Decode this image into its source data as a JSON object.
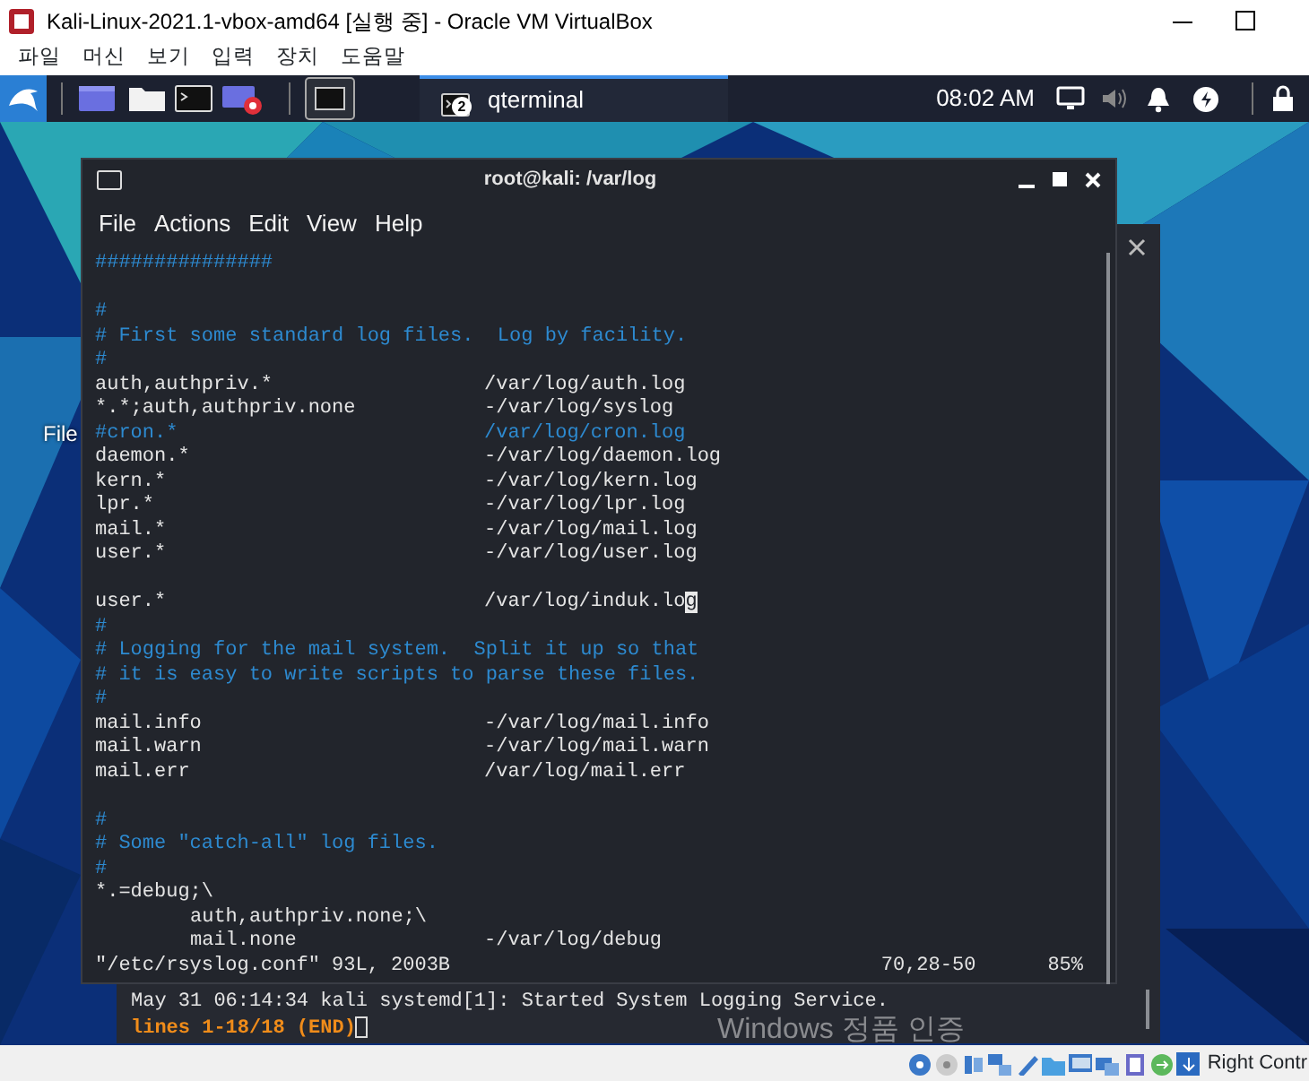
{
  "vm_window": {
    "title": "Kali-Linux-2021.1-vbox-amd64 [실행 중] - Oracle VM VirtualBox",
    "menu": [
      "파일",
      "머신",
      "보기",
      "입력",
      "장치",
      "도움말"
    ]
  },
  "panel": {
    "clock": "08:02 AM",
    "task": {
      "label": "qterminal",
      "badge": "2"
    }
  },
  "desktop": {
    "icon_label": "File"
  },
  "back_terminal": {
    "lines": [
      {
        "kind": "log",
        "text": "May 31 06:14:34 kali systemd[1]: Started System Logging Service."
      },
      {
        "kind": "pager",
        "text": "lines 1-18/18 (END)"
      }
    ]
  },
  "terminal": {
    "title": "root@kali: /var/log",
    "menu": [
      "File",
      "Actions",
      "Edit",
      "View",
      "Help"
    ],
    "lines": [
      {
        "kind": "comment",
        "text": "###############"
      },
      {
        "kind": "blank"
      },
      {
        "kind": "comment",
        "text": "#"
      },
      {
        "kind": "comment",
        "text": "# First some standard log files.  Log by facility."
      },
      {
        "kind": "comment",
        "text": "#"
      },
      {
        "kind": "rule",
        "selector": "auth,authpriv.*",
        "action": "/var/log/auth.log",
        "commented": false,
        "cursor": false
      },
      {
        "kind": "rule",
        "selector": "*.*;auth,authpriv.none",
        "action": "-/var/log/syslog",
        "commented": false,
        "cursor": false
      },
      {
        "kind": "rule",
        "selector": "#cron.*",
        "action": "/var/log/cron.log",
        "commented": true,
        "cursor": false
      },
      {
        "kind": "rule",
        "selector": "daemon.*",
        "action": "-/var/log/daemon.log",
        "commented": false,
        "cursor": false
      },
      {
        "kind": "rule",
        "selector": "kern.*",
        "action": "-/var/log/kern.log",
        "commented": false,
        "cursor": false
      },
      {
        "kind": "rule",
        "selector": "lpr.*",
        "action": "-/var/log/lpr.log",
        "commented": false,
        "cursor": false
      },
      {
        "kind": "rule",
        "selector": "mail.*",
        "action": "-/var/log/mail.log",
        "commented": false,
        "cursor": false
      },
      {
        "kind": "rule",
        "selector": "user.*",
        "action": "-/var/log/user.log",
        "commented": false,
        "cursor": false
      },
      {
        "kind": "blank"
      },
      {
        "kind": "rule",
        "selector": "user.*",
        "action": "/var/log/induk.log",
        "commented": false,
        "cursor": true
      },
      {
        "kind": "comment",
        "text": "#"
      },
      {
        "kind": "comment",
        "text": "# Logging for the mail system.  Split it up so that"
      },
      {
        "kind": "comment",
        "text": "# it is easy to write scripts to parse these files."
      },
      {
        "kind": "comment",
        "text": "#"
      },
      {
        "kind": "rule",
        "selector": "mail.info",
        "action": "-/var/log/mail.info",
        "commented": false,
        "cursor": false
      },
      {
        "kind": "rule",
        "selector": "mail.warn",
        "action": "-/var/log/mail.warn",
        "commented": false,
        "cursor": false
      },
      {
        "kind": "rule",
        "selector": "mail.err",
        "action": "/var/log/mail.err",
        "commented": false,
        "cursor": false
      },
      {
        "kind": "blank"
      },
      {
        "kind": "comment",
        "text": "#"
      },
      {
        "kind": "comment",
        "text": "# Some \"catch-all\" log files."
      },
      {
        "kind": "comment",
        "text": "#"
      },
      {
        "kind": "plain",
        "text": "*.=debug;\\"
      },
      {
        "kind": "continued",
        "text": "auth,authpriv.none;\\"
      },
      {
        "kind": "continued_rule",
        "selector": "mail.none",
        "action": "-/var/log/debug"
      }
    ],
    "status": {
      "file": "\"/etc/rsyslog.conf\" 93L, 2003B",
      "position": "70,28-50",
      "percent": "85%"
    }
  },
  "activation_notice": "Windows 정품 인증",
  "status_bar": {
    "host_key": "Right Contr"
  }
}
